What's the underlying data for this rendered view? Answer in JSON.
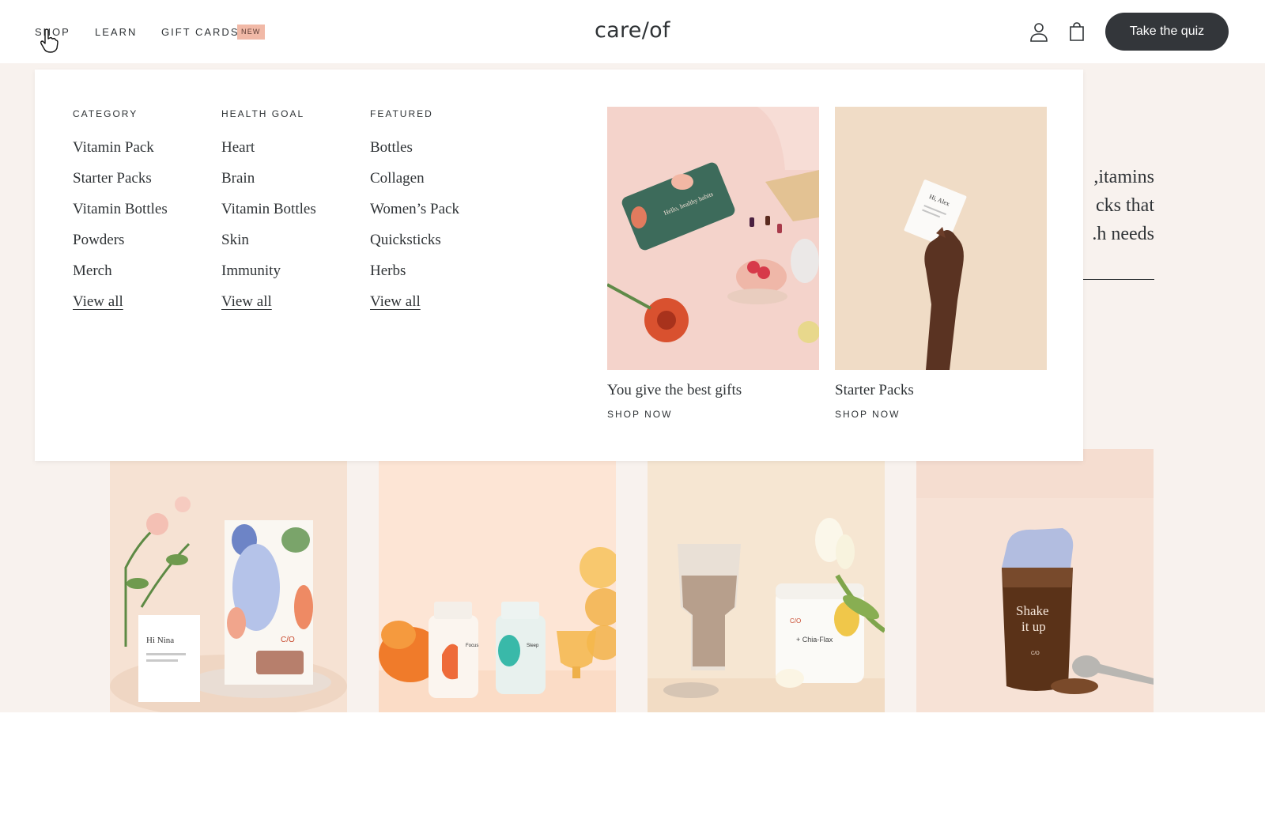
{
  "header": {
    "nav": [
      {
        "label": "SHOP"
      },
      {
        "label": "LEARN"
      },
      {
        "label": "GIFT CARDS"
      }
    ],
    "new_badge": "NEW",
    "logo": "care/of",
    "quiz_button": "Take the quiz"
  },
  "menu": {
    "columns": [
      {
        "heading": "CATEGORY",
        "items": [
          "Vitamin Pack",
          "Starter Packs",
          "Vitamin Bottles",
          "Powders",
          "Merch"
        ],
        "view_all": "View all"
      },
      {
        "heading": "HEALTH GOAL",
        "items": [
          "Heart",
          "Brain",
          "Vitamin Bottles",
          "Skin",
          "Immunity"
        ],
        "view_all": "View all"
      },
      {
        "heading": "FEATURED",
        "items": [
          "Bottles",
          "Collagen",
          "Women’s Pack",
          "Quicksticks",
          "Herbs"
        ],
        "view_all": "View all"
      }
    ],
    "promos": [
      {
        "title": "You give the best gifts",
        "cta": "SHOP NOW",
        "card_text": "Hello, healthy habits"
      },
      {
        "title": "Starter Packs",
        "cta": "SHOP NOW",
        "packet_text": "Hi, Alex"
      }
    ]
  },
  "hero": {
    "lines": [
      "itamins,",
      "cks that",
      "h needs."
    ]
  },
  "tiles": [
    {
      "packet_name": "Hi Nina",
      "box_logo": "C/O"
    },
    {
      "bottle1": "Focus",
      "bottle2": "Sleep"
    },
    {
      "jar_label": "+ Chia-Flax",
      "jar_logo": "C/O"
    },
    {
      "shaker_text_1": "Shake",
      "shaker_text_2": "it up",
      "shaker_logo": "C/O"
    }
  ],
  "colors": {
    "button_dark": "#33363a",
    "badge": "#f1b9a7",
    "page_bg": "#f8f2ee"
  }
}
